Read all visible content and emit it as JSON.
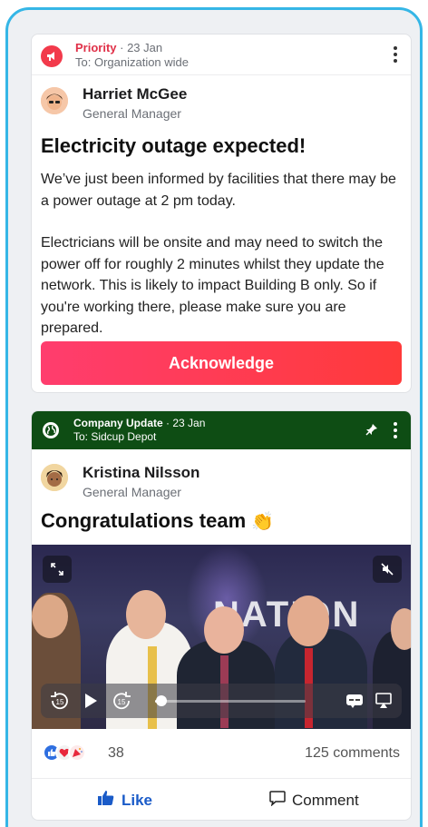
{
  "card1": {
    "priority_label": "Priority",
    "date": "· 23 Jan",
    "audience": "To: Organization wide",
    "author_name": "Harriet McGee",
    "author_role": "General Manager",
    "title": "Electricity outage expected!",
    "paragraph1": "We’ve just been informed by facilities that there may be a power outage at 2 pm today.",
    "paragraph2": "Electricians will be onsite and may need to switch the power off for roughly 2 minutes whilst they update the network. This is likely to impact Building B only. So if you're working there, please make sure you are prepared.",
    "button_label": "Acknowledge"
  },
  "card2": {
    "category": "Company Update",
    "date": "· 23 Jan",
    "audience": "To: Sidcup Depot",
    "author_name": "Kristina Nilsson",
    "author_role": "General Manager",
    "title": "Congratulations team",
    "title_emoji": "👏",
    "video": {
      "background_text": "NATION",
      "progress": 0.04
    },
    "reaction_count": "38",
    "comments_count": "125 comments",
    "like_label": "Like",
    "comment_label": "Comment"
  },
  "colors": {
    "frame": "#35b6e6",
    "priority": "#e03048",
    "acknowledge_gradient_start": "#ff3d6e",
    "acknowledge_gradient_end": "#ff3a3a",
    "company_update_header": "#0e4d14",
    "like_blue": "#1a5bc8"
  },
  "icons": {
    "priority": "megaphone-icon",
    "company_update": "globe-icon",
    "pin": "pin-icon",
    "more": "kebab-menu-icon",
    "like": "thumbs-up-icon",
    "comment": "speech-bubble-icon"
  }
}
